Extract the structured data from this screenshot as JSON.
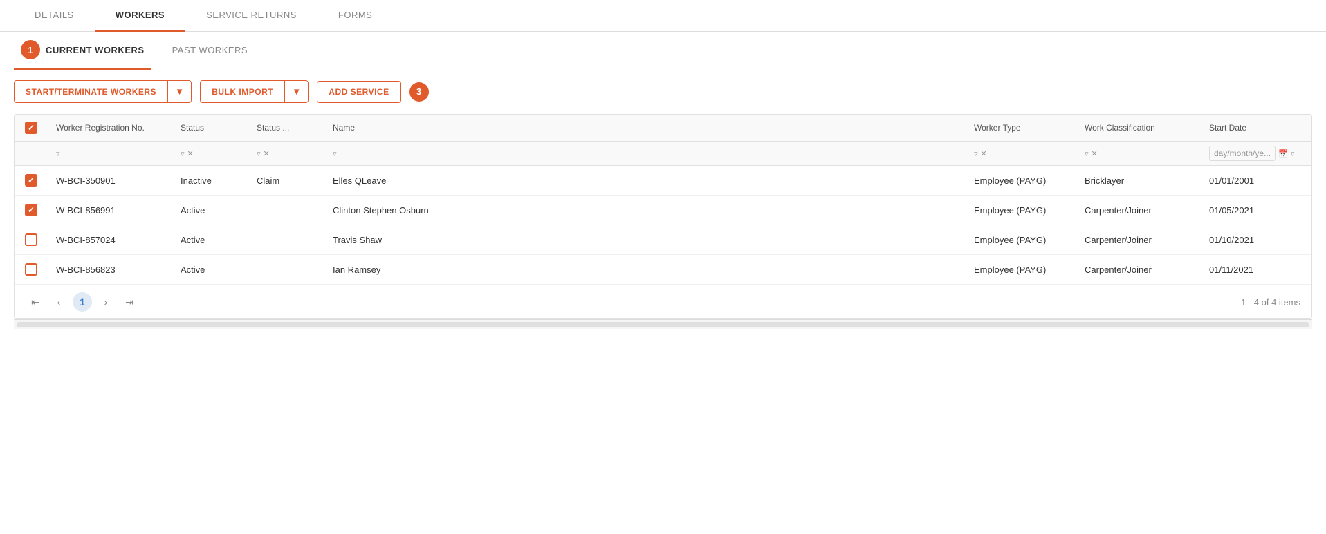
{
  "tabs": {
    "top": [
      {
        "label": "DETAILS",
        "active": false
      },
      {
        "label": "WORKERS",
        "active": true
      },
      {
        "label": "SERVICE RETURNS",
        "active": false
      },
      {
        "label": "FORMS",
        "active": false
      }
    ],
    "sub": [
      {
        "label": "CURRENT WORKERS",
        "active": true,
        "badge": "1"
      },
      {
        "label": "PAST WORKERS",
        "active": false
      }
    ]
  },
  "actions": {
    "start_terminate": "START/TERMINATE WORKERS",
    "bulk_import": "BULK IMPORT",
    "add_service": "ADD SERVICE",
    "badge3": "3"
  },
  "table": {
    "headers": [
      "Worker Registration No.",
      "Status",
      "Status ...",
      "Name",
      "Worker Type",
      "Work Classification",
      "Start Date"
    ],
    "date_placeholder": "day/month/ye...",
    "rows": [
      {
        "checked": true,
        "reg_no": "W-BCI-350901",
        "status": "Inactive",
        "status2": "Claim",
        "name": "Elles QLeave",
        "worker_type": "Employee (PAYG)",
        "work_class": "Bricklayer",
        "start_date": "01/01/2001"
      },
      {
        "checked": true,
        "reg_no": "W-BCI-856991",
        "status": "Active",
        "status2": "",
        "name": "Clinton Stephen Osburn",
        "worker_type": "Employee (PAYG)",
        "work_class": "Carpenter/Joiner",
        "start_date": "01/05/2021"
      },
      {
        "checked": false,
        "reg_no": "W-BCI-857024",
        "status": "Active",
        "status2": "",
        "name": "Travis Shaw",
        "worker_type": "Employee (PAYG)",
        "work_class": "Carpenter/Joiner",
        "start_date": "01/10/2021"
      },
      {
        "checked": false,
        "reg_no": "W-BCI-856823",
        "status": "Active",
        "status2": "",
        "name": "Ian Ramsey",
        "worker_type": "Employee (PAYG)",
        "work_class": "Carpenter/Joiner",
        "start_date": "01/11/2021"
      }
    ]
  },
  "pagination": {
    "current_page": "1",
    "info": "1 - 4 of 4 items"
  },
  "badges": {
    "sub_badge": "1",
    "action_badge": "3"
  }
}
